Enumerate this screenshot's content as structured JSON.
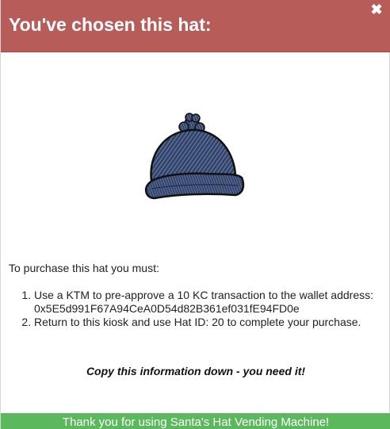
{
  "dialog": {
    "title": "You've chosen this hat:",
    "close_icon": "close-icon",
    "close_glyph": "✖"
  },
  "hat": {
    "icon": "beanie-hat-illustration",
    "color": "#3b4f78"
  },
  "instructions": {
    "intro": "To purchase this hat you must:",
    "steps": [
      "Use a KTM to pre-approve a 10 KC transaction to the wallet address: 0x5E5d991F67A94CeA0D54d82B361ef031fE94FD0e",
      "Return to this kiosk and use Hat ID: 20 to complete your purchase."
    ]
  },
  "warning": "Copy this information down - you need it!",
  "footer": {
    "message": "Thank you for using Santa's Hat Vending Machine!"
  },
  "colors": {
    "header_bg": "#b85c5a",
    "footer_bg": "#5cb85c"
  }
}
